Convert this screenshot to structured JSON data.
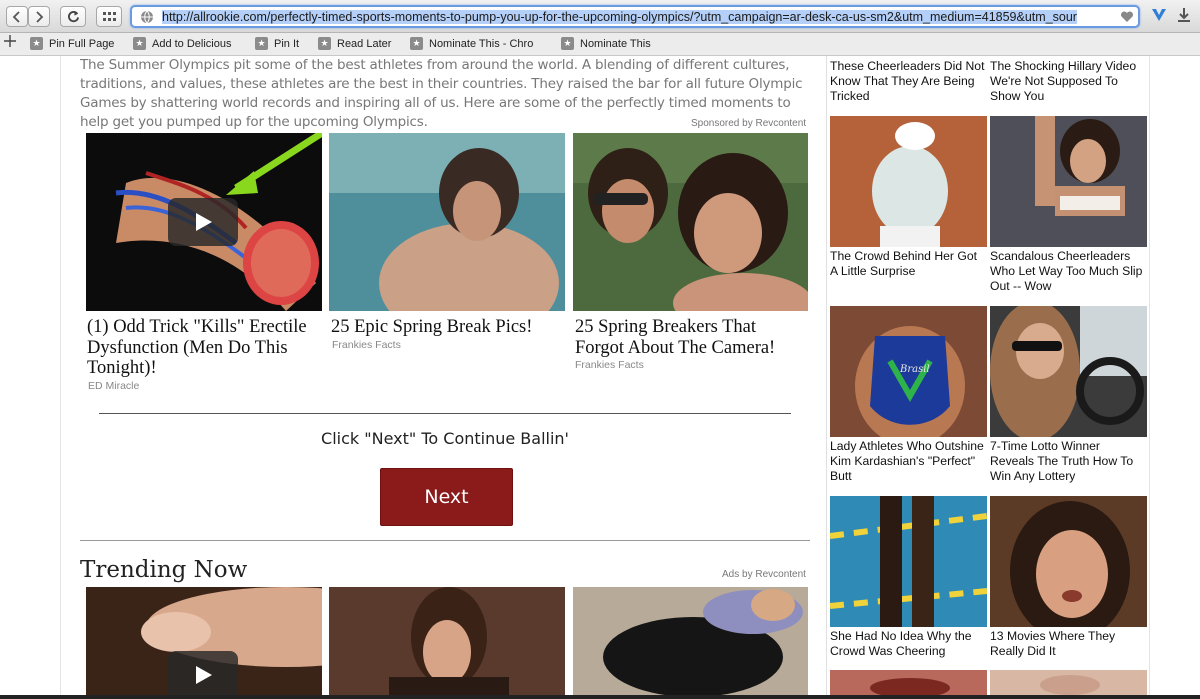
{
  "browser": {
    "url_prefix": "http://allrookie.com",
    "url_rest": "/perfectly-timed-sports-moments-to-pump-you-up-for-the-upcoming-olympics/?utm_campaign=ar-desk-ca-us-sm2&utm_medium=41859&utm_sour",
    "bookmarks": [
      {
        "label": "Pin Full Page"
      },
      {
        "label": "Add to Delicious"
      },
      {
        "label": "Pin It"
      },
      {
        "label": "Read Later"
      },
      {
        "label": "Nominate This - Chro"
      },
      {
        "label": "Nominate This"
      }
    ]
  },
  "article": {
    "intro": "The Summer Olympics pit some of the best athletes from around the world. A blending of different cultures, traditions, and values, these athletes are the best in their countries. They raised the bar for all future Olympic Games by shattering world records and inspiring all of us. Here are some of the perfectly timed moments to help get you pumped up for the upcoming Olympics."
  },
  "sponsored": {
    "tag": "Sponsored by Revcontent",
    "cards": [
      {
        "title": "(1) Odd Trick \"Kills\" Erectile Dysfunction (Men Do This Tonight)!",
        "source": "ED Miracle"
      },
      {
        "title": "25 Epic Spring Break Pics!",
        "source": "Frankies Facts"
      },
      {
        "title": "25 Spring Breakers That Forgot About The Camera!",
        "source": "Frankies Facts"
      }
    ]
  },
  "pagination": {
    "prompt": "Click \"Next\" To Continue Ballin'",
    "next_label": "Next"
  },
  "trending": {
    "title": "Trending Now",
    "tag": "Ads by Revcontent"
  },
  "sidebar": {
    "items": [
      {
        "caption": "These Cheerleaders Did Not Know That They Are Being Tricked"
      },
      {
        "caption": "The Shocking Hillary Video We're Not Supposed To Show You"
      },
      {
        "caption": "The Crowd Behind Her Got A Little Surprise"
      },
      {
        "caption": "Scandalous Cheerleaders Who Let Way Too Much Slip Out -- Wow"
      },
      {
        "caption": "Lady Athletes Who Outshine Kim Kardashian's \"Perfect\" Butt"
      },
      {
        "caption": "7-Time Lotto Winner Reveals The Truth How To Win Any Lottery"
      },
      {
        "caption": "She Had No Idea Why the Crowd Was Cheering"
      },
      {
        "caption": "13 Movies Where They Really Did It"
      }
    ],
    "jersey_text": "Brasil"
  },
  "colors": {
    "next_button": "#8b1a1a",
    "url_highlight": "#b4d0f8"
  },
  "icons": {
    "back": "chevron-left-icon",
    "forward": "chevron-right-icon",
    "reload": "reload-icon",
    "top_sites": "grid-icon",
    "play": "play-icon"
  }
}
